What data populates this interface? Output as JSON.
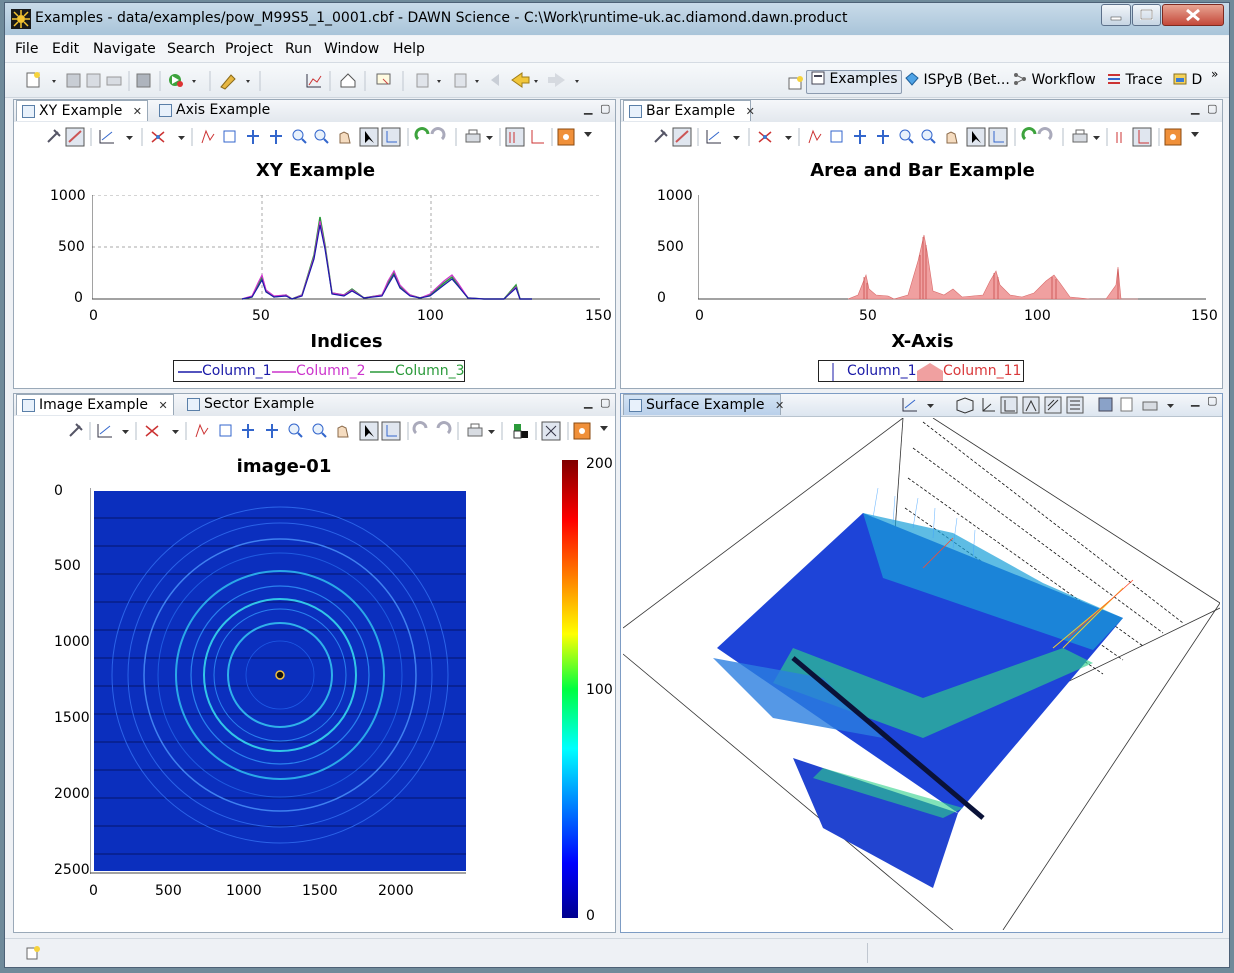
{
  "window": {
    "title": "Examples - data/examples/pow_M99S5_1_0001.cbf - DAWN Science - C:\\Work\\runtime-uk.ac.diamond.dawn.product"
  },
  "menu": [
    "File",
    "Edit",
    "Navigate",
    "Search",
    "Project",
    "Run",
    "Window",
    "Help"
  ],
  "perspectives": {
    "items": [
      "Examples",
      "ISPyB (Bet...",
      "Workflow",
      "Trace",
      "D"
    ],
    "active": "Examples",
    "more": "»"
  },
  "views": {
    "xy": {
      "tabs": [
        "XY Example",
        "Axis Example"
      ],
      "title": "XY Example",
      "xlabel": "Indices",
      "yticks": [
        "1000",
        "500",
        "0"
      ],
      "xticks": [
        "0",
        "50",
        "100",
        "150"
      ],
      "legend": [
        {
          "name": "Column_1",
          "color": "#1a1aa8"
        },
        {
          "name": "Column_2",
          "color": "#cc33cc"
        },
        {
          "name": "Column_3",
          "color": "#2a9a3a"
        }
      ]
    },
    "bar": {
      "tabs": [
        "Bar Example"
      ],
      "title": "Area and Bar Example",
      "xlabel": "X-Axis",
      "yticks": [
        "1000",
        "500",
        "0"
      ],
      "xticks": [
        "0",
        "50",
        "100",
        "150"
      ],
      "legend": [
        {
          "name": "Column_1",
          "color": "#1a1aa8"
        },
        {
          "name": "Column_11",
          "color": "#d9383a"
        }
      ]
    },
    "image": {
      "tabs": [
        "Image Example",
        "Sector Example"
      ],
      "title": "image-01",
      "yticks": [
        "0",
        "500",
        "1000",
        "1500",
        "2000",
        "2500"
      ],
      "xticks": [
        "0",
        "500",
        "1000",
        "1500",
        "2000"
      ],
      "colorbar_ticks": [
        "200",
        "100",
        "0"
      ]
    },
    "surface": {
      "tabs": [
        "Surface Example"
      ]
    }
  },
  "close_glyph": "✕",
  "min_glyph": "▁",
  "max_glyph": "▢",
  "colors": {
    "accent_tab": "#bad0ea",
    "image_bg": "#0b2fbe",
    "bar_fill": "#f0a0a0"
  }
}
